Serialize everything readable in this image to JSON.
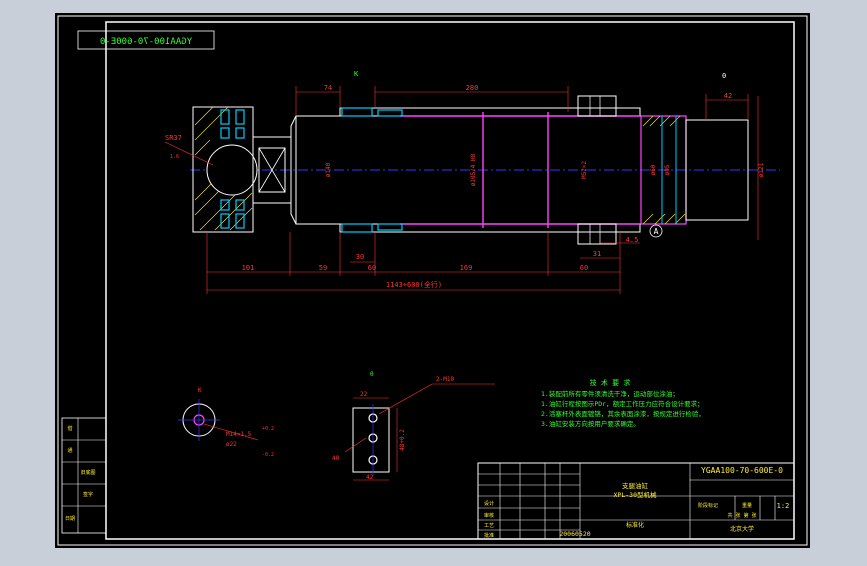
{
  "colors": {
    "background": "#c9cfd8",
    "paper": "#000000",
    "frame": "#ffffff",
    "dim": "#ff3333",
    "centerline": "#3333ff",
    "hatch": "#00ccff",
    "note": "#33ff33",
    "magenta": "#ff44ff"
  },
  "drawing": {
    "code_mirrored": "YGAA100-70-600E-0",
    "section_label_top": "K",
    "section_label_right": "0",
    "view_label_o": "0",
    "view_label_k": "K",
    "detail_marker": "A",
    "dims": {
      "d74": "74",
      "d280": "280",
      "d42_right": "42",
      "d101": "101",
      "d59": "59",
      "d30": "30",
      "d60a": "60",
      "d169": "169",
      "d60b": "60",
      "d31": "31",
      "d4_5": "4.5",
      "overall": "1143+600(全行)",
      "phi40": "ø140",
      "phi105": "ø105/4 H8",
      "m52": "M52×2",
      "phi120": "ø121",
      "phi60": "ø60",
      "phi95": "ø95",
      "sr_left": "SR37",
      "hole_spec": "2-M10",
      "d22": "22",
      "d40": "40",
      "d42_bot": "42",
      "d48": "48+0.2",
      "hole_dim1": "M14×1.5",
      "hole_dim2": "ø22",
      "tol1": "+0.2",
      "tol2": "-0.2",
      "small_1_6": "1.6"
    },
    "notes": {
      "title": "技 术 要 求",
      "line1": "1.装配前所有零件须清洗干净，运动部位涂油；",
      "line2": "1.油缸行程按图示PDr，额定工作压力应符合设计要求；",
      "line3": "2.活塞杆外表面镀铬，其余表面涂漆，按规定进行检验，",
      "line4": "3.油缸安装方向按用户要求确定。"
    },
    "title_block": {
      "code": "YGAA100-70-600E-0",
      "name_line1": "支腿油缸",
      "name_line2": "XPL-30型机械",
      "scale": "1:2",
      "company": "北京大学",
      "date": "20060520",
      "approve": "标准化",
      "design": "设计",
      "check": "审核",
      "process": "工艺",
      "batch": "批准",
      "weight_label": "重量",
      "sheet_label": "共 张 第 张",
      "stage_label": "阶段标记"
    },
    "left_table": {
      "r1": "借",
      "r2": "通",
      "r3": "旧底图",
      "r4": "签字",
      "r5": "日期"
    }
  }
}
